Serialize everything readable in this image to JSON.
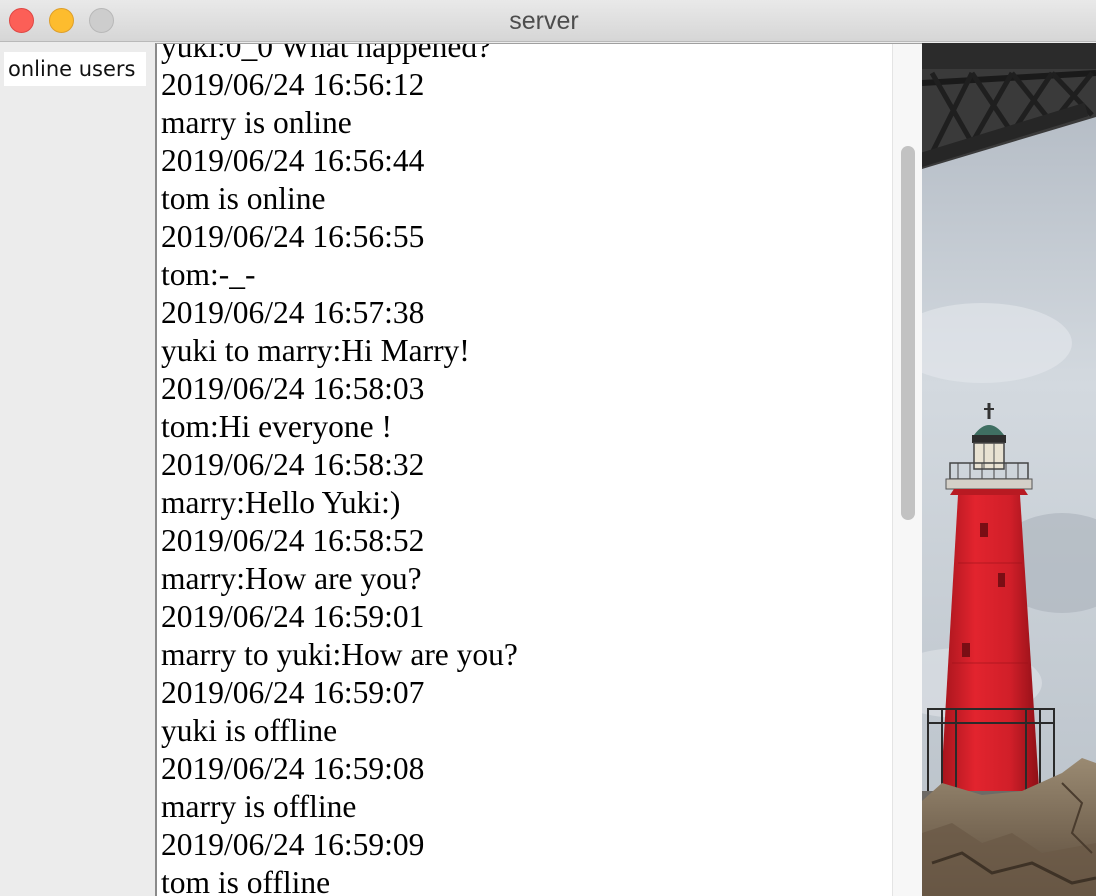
{
  "window": {
    "title": "server",
    "buttons": [
      {
        "name": "close",
        "color": "#fc5f57"
      },
      {
        "name": "minimize",
        "color": "#fdbc2e"
      },
      {
        "name": "zoom",
        "color": "#cdcdcd"
      }
    ]
  },
  "users_panel": {
    "label": "online users"
  },
  "log": {
    "lines": [
      "yuki:0_0 What happened?",
      "2019/06/24 16:56:12",
      "marry is online",
      "2019/06/24 16:56:44",
      "tom is online",
      "2019/06/24 16:56:55",
      "tom:-_-",
      "2019/06/24 16:57:38",
      "yuki to marry:Hi Marry!",
      "2019/06/24 16:58:03",
      "tom:Hi everyone !",
      "2019/06/24 16:58:32",
      "marry:Hello Yuki:)",
      "2019/06/24 16:58:52",
      "marry:How are you?",
      "2019/06/24 16:59:01",
      "marry to yuki:How are you?",
      "2019/06/24 16:59:07",
      "yuki is offline",
      "2019/06/24 16:59:08",
      "marry is offline",
      "2019/06/24 16:59:09",
      "tom is offline"
    ]
  },
  "image_panel": {
    "subject": "red-lighthouse-image",
    "colors": {
      "sky": "#c7cfd8",
      "tower": "#d8222c",
      "rock": "#8a7660",
      "bridge": "#2a2a2a"
    }
  }
}
